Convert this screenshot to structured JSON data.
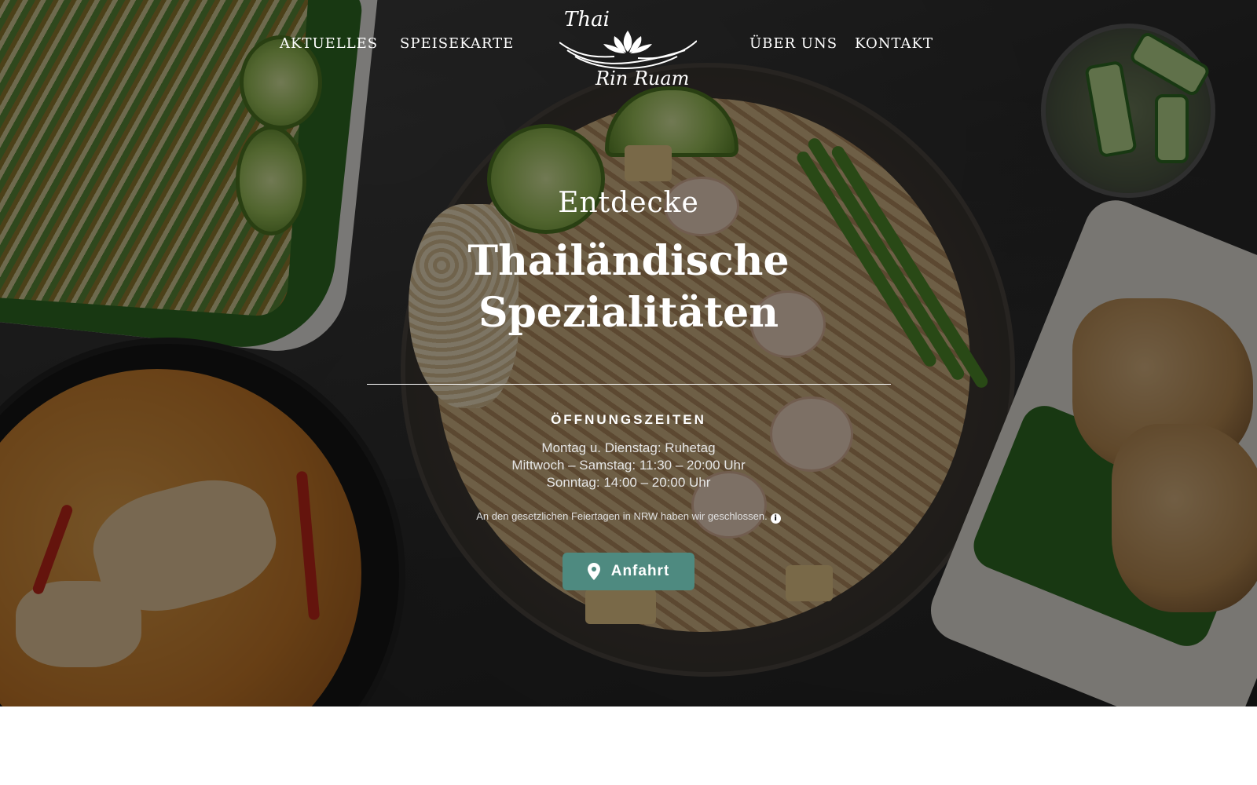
{
  "nav": {
    "left": [
      "AKTUELLES",
      "SPEISEKARTE"
    ],
    "right": [
      "ÜBER UNS",
      "KONTAKT"
    ]
  },
  "logo": {
    "line1": "Thai",
    "line2": "Rin Ruam",
    "icon": "lotus-logo-icon"
  },
  "hero": {
    "kicker": "Entdecke",
    "headline_line1": "Thailändische",
    "headline_line2": "Spezialitäten",
    "hours_title": "ÖFFNUNGSZEITEN",
    "hours": [
      "Montag u. Dienstag: Ruhetag",
      "Mittwoch – Samstag: 11:30 – 20:00 Uhr",
      "Sonntag: 14:00 – 20:00 Uhr"
    ],
    "holiday_note": "An den gesetzlichen Feiertagen in NRW haben wir geschlossen.",
    "info_icon": "info-icon",
    "button_label": "Anfahrt",
    "button_icon": "map-pin-icon"
  },
  "colors": {
    "button": "#4e8a80",
    "overlay_text": "#ffffff"
  }
}
